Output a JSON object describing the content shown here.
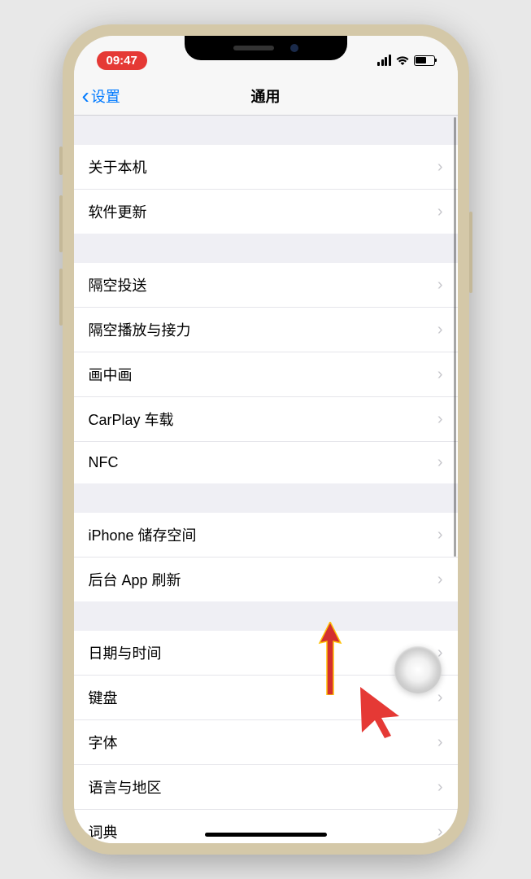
{
  "statusBar": {
    "time": "09:47"
  },
  "nav": {
    "backLabel": "设置",
    "title": "通用"
  },
  "sections": [
    {
      "rows": [
        {
          "label": "关于本机"
        },
        {
          "label": "软件更新"
        }
      ]
    },
    {
      "rows": [
        {
          "label": "隔空投送"
        },
        {
          "label": "隔空播放与接力"
        },
        {
          "label": "画中画"
        },
        {
          "label": "CarPlay 车载"
        },
        {
          "label": "NFC"
        }
      ]
    },
    {
      "rows": [
        {
          "label": "iPhone 储存空间"
        },
        {
          "label": "后台 App 刷新"
        }
      ]
    },
    {
      "rows": [
        {
          "label": "日期与时间"
        },
        {
          "label": "键盘"
        },
        {
          "label": "字体"
        },
        {
          "label": "语言与地区"
        },
        {
          "label": "词典"
        }
      ]
    }
  ]
}
